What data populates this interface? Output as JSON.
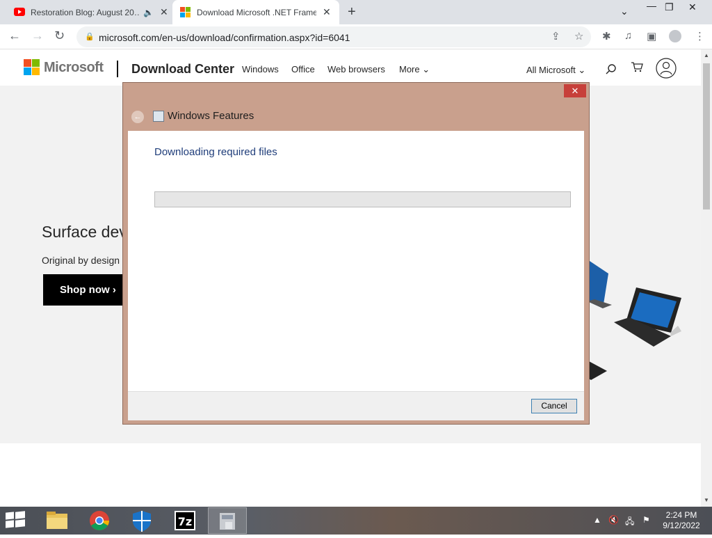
{
  "browser": {
    "tabs": [
      {
        "title": "Restoration Blog: August 20…",
        "active": false
      },
      {
        "title": "Download Microsoft .NET Frame…",
        "active": true
      }
    ],
    "url": "microsoft.com/en-us/download/confirmation.aspx?id=6041"
  },
  "site": {
    "brand": "Microsoft",
    "section": "Download Center",
    "nav": [
      "Windows",
      "Office",
      "Web browsers",
      "More"
    ],
    "all_microsoft": "All Microsoft",
    "hero_title": "Surface dev",
    "hero_subtitle": "Original by design",
    "shop_label": "Shop now"
  },
  "dialog": {
    "title": "Windows Features",
    "heading": "Downloading required files",
    "progress": 0,
    "cancel_label": "Cancel"
  },
  "taskbar": {
    "time": "2:24 PM",
    "date": "9/12/2022",
    "apps": [
      "file-explorer",
      "chrome",
      "windows-defender",
      "7zip",
      "installer"
    ]
  },
  "icons": {
    "ms_red": "#f25022",
    "ms_green": "#7fba00",
    "ms_blue": "#00a4ef",
    "ms_yellow": "#ffb900"
  }
}
